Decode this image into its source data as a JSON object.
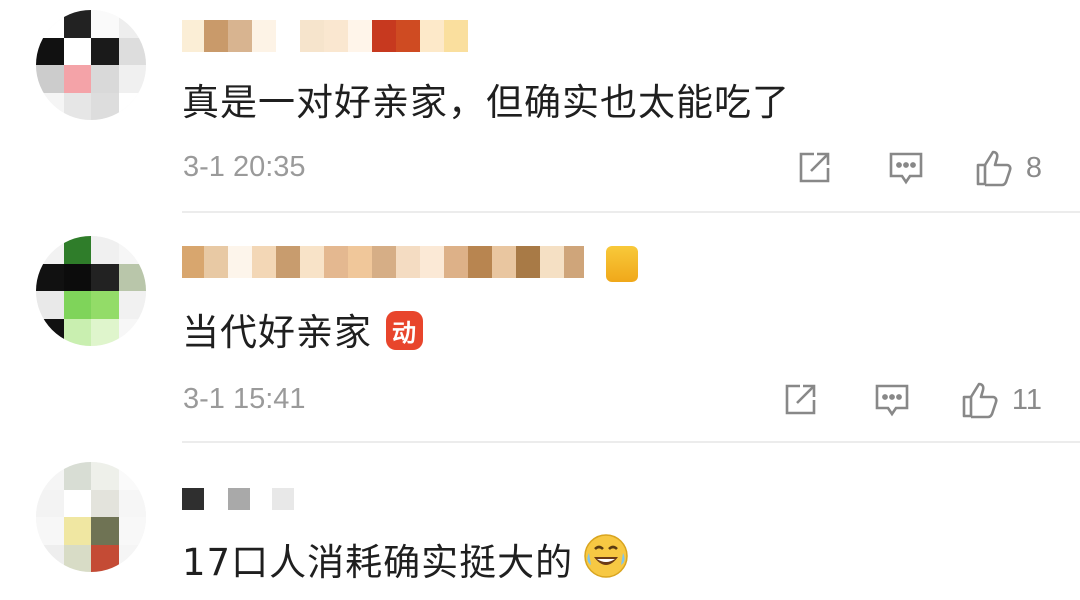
{
  "comments": [
    {
      "text": "真是一对好亲家，但确实也太能吃了",
      "time": "3-1 20:35",
      "likes": "8",
      "icons": [
        "share-icon",
        "reply-icon",
        "like-icon"
      ]
    },
    {
      "text": "当代好亲家",
      "emoji_label": "动",
      "time": "3-1 15:41",
      "likes": "11",
      "icons": [
        "share-icon",
        "reply-icon",
        "like-icon"
      ]
    },
    {
      "text": "17口人消耗确实挺大的",
      "emoji": "laughing-tears-emoji"
    }
  ],
  "colors": {
    "text": "#1f1f1f",
    "meta": "#9a9a9a",
    "divider": "#ececec",
    "emoji_red": "#e8452c"
  }
}
